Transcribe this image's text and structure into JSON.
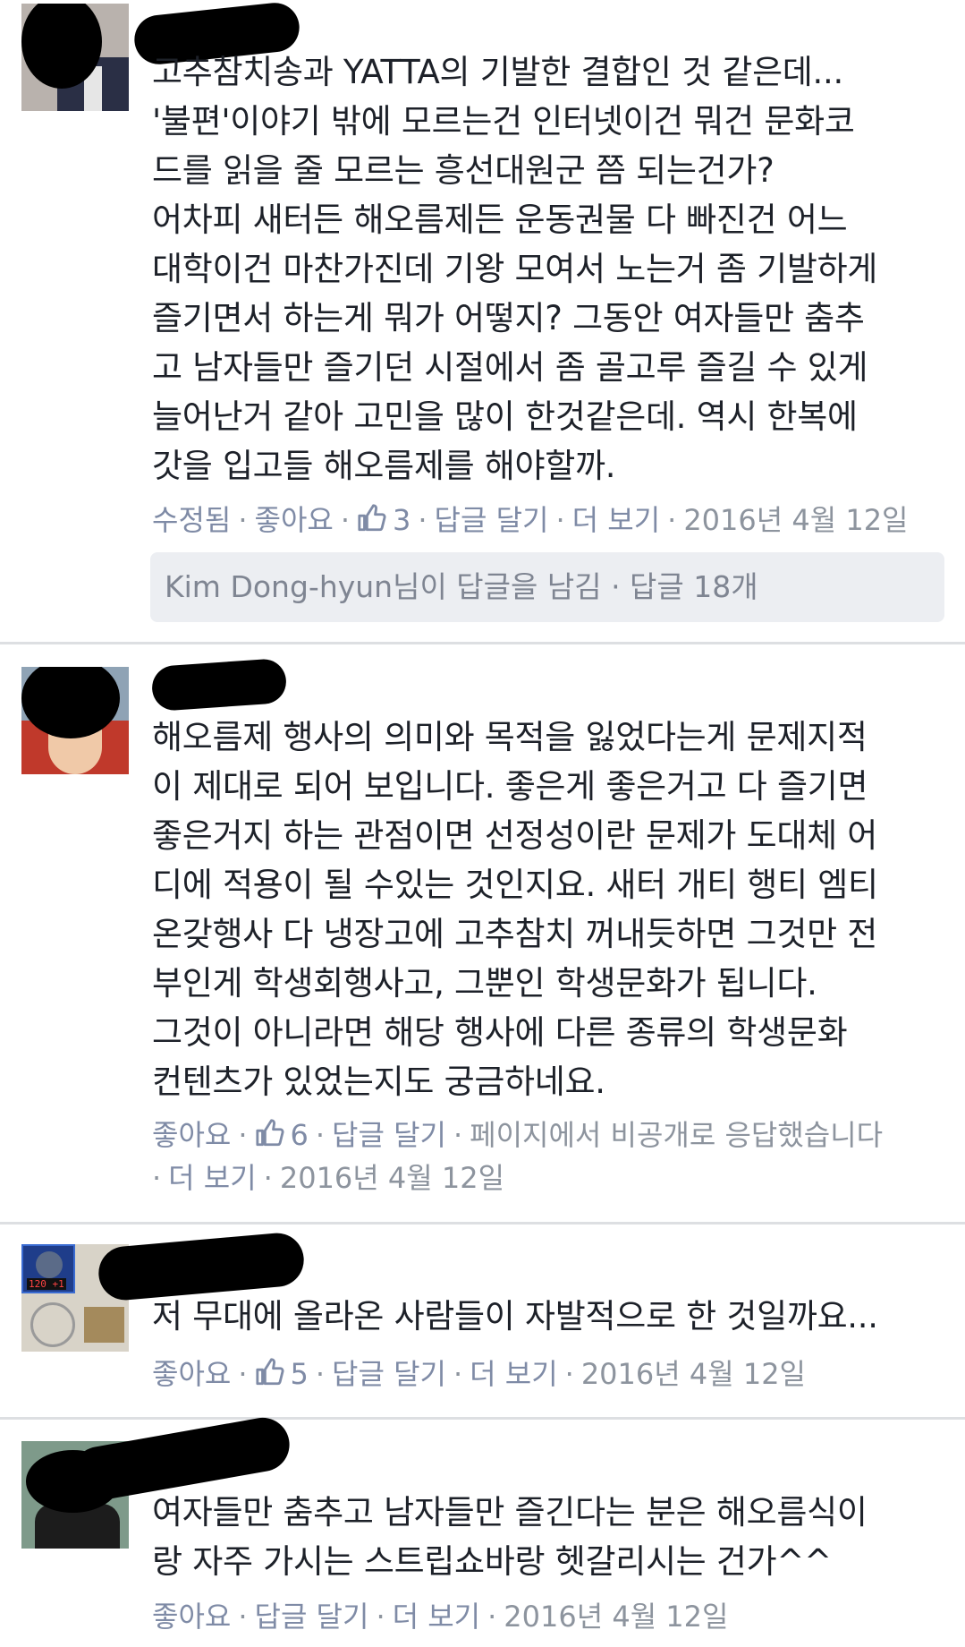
{
  "comments": [
    {
      "lines": [
        "고추참치송과 YATTA의 기발한 결합인 것 같은데...",
        "'불편'이야기 밖에 모르는건 인터넷이건 뭐건 문화코",
        "드를 읽을 줄 모르는 흥선대원군 쯤 되는건가?",
        "어차피 새터든 해오름제든 운동권물 다 빠진건 어느",
        "대학이건 마찬가진데 기왕 모여서 노는거 좀 기발하게",
        "즐기면서 하는게 뭐가 어떻지? 그동안 여자들만 춤추",
        "고 남자들만 즐기던 시절에서 좀 골고루 즐길 수 있게",
        "늘어난거 같아 고민을 많이 한것같은데. 역시 한복에",
        "갓을 입고들 해오름제를 해야할까."
      ],
      "meta": {
        "edited": "수정됨",
        "like": "좋아요",
        "like_count": "3",
        "reply": "답글 달기",
        "more": "더 보기",
        "date": "2016년 4월 12일"
      },
      "reply_summary": "Kim Dong-hyun님이 답글을 남김 · 답글 18개"
    },
    {
      "lines": [
        "해오름제 행사의 의미와 목적을 잃었다는게 문제지적",
        "이 제대로 되어 보입니다. 좋은게 좋은거고 다 즐기면",
        "좋은거지 하는 관점이면 선정성이란 문제가 도대체 어",
        "디에 적용이 될 수있는 것인지요. 새터 개티 행티 엠티",
        "온갖행사 다 냉장고에 고추참치 꺼내듯하면 그것만 전",
        "부인게 학생회행사고, 그뿐인 학생문화가 됩니다.",
        "그것이 아니라면 해당 행사에 다른 종류의 학생문화",
        "컨텐츠가 있었는지도 궁금하네요."
      ],
      "meta": {
        "like": "좋아요",
        "like_count": "6",
        "reply": "답글 달기",
        "page_reply": "페이지에서 비공개로 응답했습니다",
        "more": "더 보기",
        "date": "2016년 4월 12일"
      }
    },
    {
      "lines": [
        "저 무대에 올라온 사람들이 자발적으로 한 것일까요..."
      ],
      "meta": {
        "like": "좋아요",
        "like_count": "5",
        "reply": "답글 달기",
        "more": "더 보기",
        "date": "2016년 4월 12일"
      },
      "avatar_badge": "120 +1"
    },
    {
      "lines": [
        "여자들만 춤추고 남자들만 즐긴다는 분은 해오름식이",
        "랑 자주 가시는 스트립쇼바랑 헷갈리시는 건가^^"
      ],
      "meta": {
        "like": "좋아요",
        "reply": "답글 달기",
        "more": "더 보기",
        "date": "2016년 4월 12일"
      }
    }
  ],
  "colors": {
    "link": "#7f8ba6",
    "meta": "#8d949e",
    "text": "#1d2129",
    "reply_box": "#eceef2",
    "divider": "#dddfe2"
  },
  "icons": [
    "thumbs-up-icon"
  ]
}
